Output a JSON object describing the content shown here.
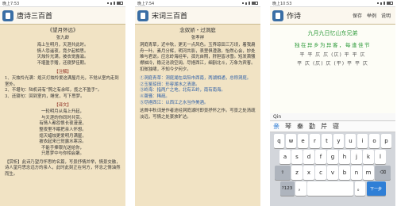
{
  "phone1": {
    "status": {
      "time": "晚上7:53"
    },
    "app_title": "唐诗三百首",
    "poem_title": "《望月怀远》",
    "author": "张九龄",
    "poem_lines": [
      "海上生明月，天涯共此时。",
      "情人怨遥夜，竟夕起相思。",
      "灭烛怜光满，披衣觉露滋。",
      "不堪盈手赠，还寝梦佳期。"
    ],
    "note_header": "【注解】",
    "notes": [
      "1、灭烛怜光满：熄灭灯烛怜爱这满屋月光，不觉从室内走到室外。",
      "2、不堪句：陆机诗有“照之有余晖，揽之不盈手”。",
      "3、还寝句：回到室内，睡觉，写下思梦。"
    ],
    "translation_header": "【译文】",
    "translation_lines": [
      "一轮明月从海上升起，",
      "与天涯的你同时共赏。",
      "有情人都怨恨长夜漫漫，",
      "整夜里不眠把亲人怀想。",
      "熄灭蜡烛更爱明月满屋，",
      "披衣起来已觉露水寒凉。",
      "不能手捧银光送给你，",
      "只愿梦中与你相会聚。"
    ],
    "commentary": "【赏析】此诗乃望月怀思的名篇，写景抒情并举，情景交融，诗人望月思念远方的亲人，此时此刻正在何方，怀念之情油然而生。"
  },
  "phone2": {
    "status": {
      "time": "晚上7:54"
    },
    "app_title": "宋词三百首",
    "poem_title": "念奴娇・过洞庭",
    "author": "张孝祥",
    "poem_body": "洞庭青草，近中秋，更无一点风色。玉界琼田三万顷，着我扁舟一叶。素月分辉，明河共影，表里俱澄澈。怡然心会，妙处难与君说。应念岭海经年，孤光自照，肝胆皆冰雪。短发萧骚襟袖冷，稳泛沧浪空阔。尽挹西江，细斟北斗，万象为宾客。扣舷独啸，不知今夕何夕。",
    "notes": [
      "①洞庭青草：洞庭湖在岳阳市西南，两湖相通，总称洞庭。",
      "②玉鉴琼田：形容湖水之清澈。",
      "③岭海：指两广之地，北有五岭，南有南海。",
      "④萧骚：稀疏。",
      "⑤尽挹西江：以西江之水当作美酒。"
    ],
    "commentary": "这首中秋词是作者途经洞庭湖时即景抒怀之作。写景之处清疏淡远，写情之处豪放旷达。"
  },
  "phone3": {
    "status": {
      "time": "晚上10:53"
    },
    "app_title": "作诗",
    "save_label": "保存",
    "example_label": "举例",
    "rules_label": "说明",
    "poem_name": "九月九日忆山东兄弟",
    "char_line": "独在异乡为异客，每逢佳节",
    "tone_line1": "平 平 仄 仄 (仄) 平 平 仄",
    "tone_line2": "平 仄 (仄) 仄 (平) 平 平 仄",
    "ime_input": "Qin",
    "candidates": [
      "亲",
      "琴",
      "秦",
      "勤",
      "芹",
      "寝"
    ],
    "keys_row1": [
      "q",
      "w",
      "e",
      "r",
      "t",
      "y",
      "u",
      "i",
      "o",
      "p"
    ],
    "keys_row2": [
      "a",
      "s",
      "d",
      "f",
      "g",
      "h",
      "j",
      "k",
      "l"
    ],
    "keys_row3": [
      "z",
      "x",
      "c",
      "v",
      "b",
      "n",
      "m"
    ],
    "shift_label": "⇧",
    "del_label": "⌫",
    "num_label": "?123",
    "comma_label": "，",
    "space_label": "",
    "period_label": "。",
    "enter_label": "下一步"
  }
}
